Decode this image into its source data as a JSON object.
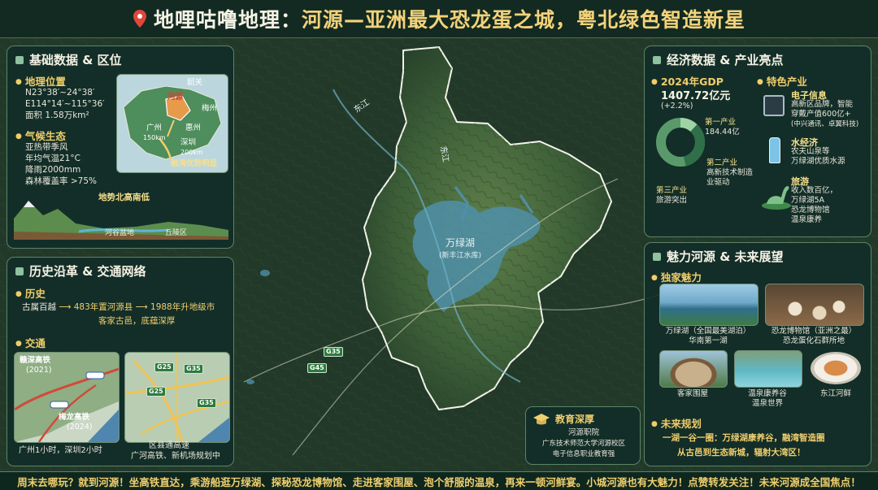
{
  "title": {
    "prefix": "地哩咕噜地理：",
    "main": "河源—亚洲最大恐龙蛋之城，粤北绿色智造新星"
  },
  "panels": {
    "basic": {
      "title": "基础数据 & 区位",
      "location": {
        "heading": "地理位置",
        "lines": [
          "N23°38′~24°38′",
          "E114°14′~115°36′",
          "面积 1.58万km²"
        ]
      },
      "climate": {
        "heading": "气候生态",
        "lines": [
          "亚热带季风",
          "年均气温21°C",
          "降雨2000mm",
          "森林覆盖率 >75%"
        ]
      },
      "inset_map": {
        "labels": [
          "韶关",
          "河源",
          "梅州",
          "广州",
          "惠州",
          "深圳"
        ],
        "dist_gz": "150km",
        "dist_sz": "200km",
        "note": "融湾优势明显"
      },
      "terrain": {
        "title": "地势北高南低",
        "labels": [
          "河谷盆地",
          "丘陵区"
        ]
      }
    },
    "history": {
      "title": "历史沿革 & 交通网络",
      "history_heading": "历史",
      "timeline": [
        "古属百越",
        "483年置河源县",
        "1988年升地级市"
      ],
      "history_note": "客家古邑，底蕴深厚",
      "traffic_heading": "交通",
      "rail": {
        "name1": "赣深高铁",
        "year1": "(2021)",
        "name2": "梅龙高铁",
        "year2": "(2024)"
      },
      "highways": [
        "G25",
        "G35",
        "G25",
        "G35"
      ],
      "caption_left": "广州1小时，深圳2小时",
      "caption_right_1": "区县通高速",
      "caption_right_2": "广河高铁、新机场规划中"
    },
    "economy": {
      "title": "经济数据 & 产业亮点",
      "gdp_label": "2024年GDP",
      "gdp_value": "1407.72亿元",
      "gdp_growth": "(+2.2%)",
      "donut": {
        "primary_label": "第一产业",
        "primary_value": "184.44亿",
        "secondary_label": "第二产业",
        "secondary_desc": [
          "高新技术制造",
          "业驱动"
        ],
        "tertiary_label": "第三产业",
        "tertiary_desc": "旅游突出"
      },
      "industry_heading": "特色产业",
      "industries": [
        {
          "name": "电子信息",
          "desc": [
            "高新区品牌，智能",
            "穿戴产值600亿+",
            "(中兴通讯、卓翼科技)"
          ]
        },
        {
          "name": "水经济",
          "desc": [
            "农夫山泉等",
            "万绿湖优质水源"
          ]
        },
        {
          "name": "旅游",
          "desc": [
            "收入数百亿，",
            "万绿湖5A",
            "恐龙博物馆",
            "温泉康养"
          ]
        }
      ]
    },
    "charm": {
      "title": "魅力河源 & 未来展望",
      "unique_heading": "独家魅力",
      "photos": [
        {
          "caption1": "万绿湖（全国最美湖泊）",
          "caption2": "华南第一湖"
        },
        {
          "caption1": "恐龙博物馆（亚洲之最）",
          "caption2": "恐龙蛋化石群所地"
        },
        {
          "caption1": "客家围屋",
          "caption2": ""
        },
        {
          "caption1": "温泉康养谷",
          "caption2": "温泉世界"
        },
        {
          "caption1": "东江河鲜",
          "caption2": ""
        }
      ],
      "future_heading": "未来规划",
      "future_line1": "一湖一谷一圈：万绿湖康养谷，融湾智造圈",
      "future_line2": "从古邑到生态新城，辐射大湾区！"
    },
    "education": {
      "title": "教育深厚",
      "lines": [
        "河源职院",
        "广东技术师范大学河源校区",
        "电子信息职业教育强"
      ]
    }
  },
  "map": {
    "lake_name": "万绿湖",
    "lake_sub": "(新丰江水库)",
    "river_label": "东江",
    "river_label2": "东江",
    "road_badges": [
      "G35",
      "G45"
    ]
  },
  "bottom_text": "周末去哪玩？就到河源！坐高铁直达，乘游船逛万绿湖、探秘恐龙博物馆、走进客家围屋、泡个舒服的温泉，再来一顿河鲜宴。小城河源也有大魅力！点赞转发关注！未来河源成全国焦点！",
  "colors": {
    "accent_gold": "#f2cf6d",
    "panel_bg": "#122e28",
    "lake_blue": "#4f8fa8"
  }
}
